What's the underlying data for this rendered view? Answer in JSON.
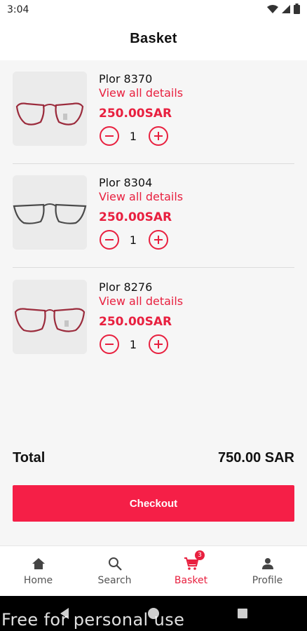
{
  "status_bar": {
    "time": "3:04",
    "icons": [
      "wifi-icon",
      "signal-icon",
      "battery-icon"
    ]
  },
  "header": {
    "title": "Basket"
  },
  "items": [
    {
      "name": "Plor 8370",
      "details_link": "View all details",
      "price": "250.00SAR",
      "quantity": "1",
      "frame_color": "#9b2b3c"
    },
    {
      "name": "Plor 8304",
      "details_link": "View all details",
      "price": "250.00SAR",
      "quantity": "1",
      "frame_color": "#4a4a4a"
    },
    {
      "name": "Plor 8276",
      "details_link": "View all details",
      "price": "250.00SAR",
      "quantity": "1",
      "frame_color": "#9b2b3c"
    }
  ],
  "summary": {
    "total_label": "Total",
    "total_value": "750.00 SAR"
  },
  "checkout": {
    "label": "Checkout"
  },
  "bottom_nav": {
    "items": [
      {
        "label": "Home",
        "icon": "home-icon"
      },
      {
        "label": "Search",
        "icon": "search-icon"
      },
      {
        "label": "Basket",
        "icon": "cart-icon",
        "badge": "3",
        "active": true
      },
      {
        "label": "Profile",
        "icon": "person-icon"
      }
    ]
  },
  "watermark": "Free for personal use",
  "colors": {
    "accent": "#e8203f",
    "checkout": "#f51f47",
    "background": "#f6f6f6"
  }
}
